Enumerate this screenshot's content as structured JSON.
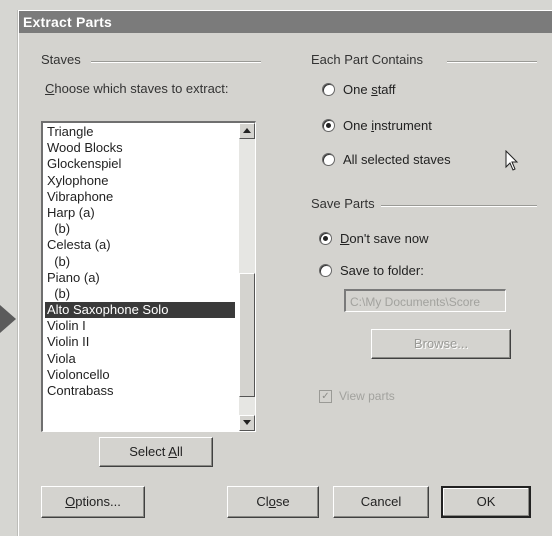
{
  "window": {
    "title": "Extract Parts"
  },
  "staves": {
    "group_label": "Staves",
    "prompt": "Choose which staves to extract:",
    "items": [
      "Triangle",
      "Wood Blocks",
      "Glockenspiel",
      "Xylophone",
      "Vibraphone",
      "Harp (a)",
      "  (b)",
      "Celesta (a)",
      "  (b)",
      "Piano (a)",
      "  (b)",
      "Alto Saxophone Solo",
      "Violin I",
      "Violin II",
      "Viola",
      "Violoncello",
      "Contrabass"
    ],
    "selected_item": "Alto Saxophone Solo",
    "select_all_label": "Select All"
  },
  "each_part": {
    "group_label": "Each Part Contains",
    "options": [
      "One staff",
      "One instrument",
      "All selected staves"
    ],
    "selected": "One instrument"
  },
  "save_parts": {
    "group_label": "Save Parts",
    "options": [
      "Don't save now",
      "Save to folder:"
    ],
    "selected": "Don't save now",
    "folder_path": "C:\\My Documents\\Score",
    "browse_label": "Browse...",
    "view_parts_label": "View parts",
    "view_parts_checked": true
  },
  "buttons": {
    "options": "Options...",
    "close": "Close",
    "cancel": "Cancel",
    "ok": "OK"
  },
  "icons": {
    "scroll_up": "up-arrow-icon",
    "scroll_down": "down-arrow-icon",
    "cursor": "mouse-pointer-icon",
    "callout": "callout-arrow-icon"
  }
}
